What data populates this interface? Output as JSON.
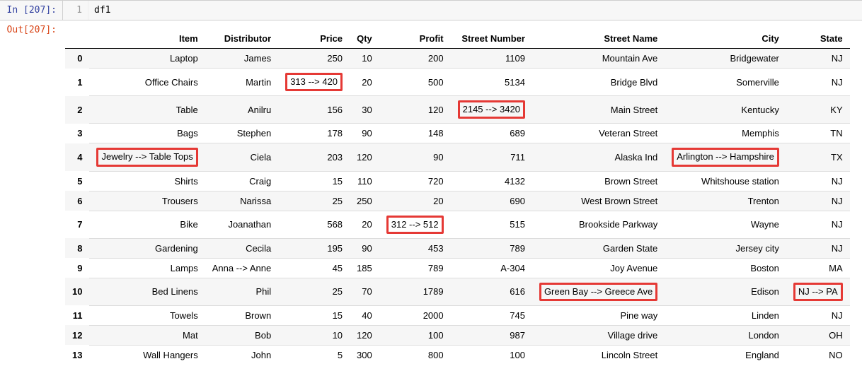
{
  "input_cell": {
    "prompt": "In [207]:",
    "line_number": "1",
    "code": "df1"
  },
  "output_cell": {
    "prompt": "Out[207]:"
  },
  "table": {
    "columns": [
      "Item",
      "Distributor",
      "Price",
      "Qty",
      "Profit",
      "Street Number",
      "Street Name",
      "City",
      "State"
    ],
    "highlight_map": {
      "1": [
        "Price"
      ],
      "2": [
        "Street Number"
      ],
      "4": [
        "Item",
        "City"
      ],
      "7": [
        "Profit"
      ],
      "10": [
        "Street Name",
        "State"
      ]
    },
    "rows": [
      {
        "idx": "0",
        "Item": "Laptop",
        "Distributor": "James",
        "Price": "250",
        "Qty": "10",
        "Profit": "200",
        "Street Number": "1109",
        "Street Name": "Mountain Ave",
        "City": "Bridgewater",
        "State": "NJ"
      },
      {
        "idx": "1",
        "Item": "Office Chairs",
        "Distributor": "Martin",
        "Price": "313 --> 420",
        "Qty": "20",
        "Profit": "500",
        "Street Number": "5134",
        "Street Name": "Bridge Blvd",
        "City": "Somerville",
        "State": "NJ"
      },
      {
        "idx": "2",
        "Item": "Table",
        "Distributor": "Anilru",
        "Price": "156",
        "Qty": "30",
        "Profit": "120",
        "Street Number": "2145 --> 3420",
        "Street Name": "Main Street",
        "City": "Kentucky",
        "State": "KY"
      },
      {
        "idx": "3",
        "Item": "Bags",
        "Distributor": "Stephen",
        "Price": "178",
        "Qty": "90",
        "Profit": "148",
        "Street Number": "689",
        "Street Name": "Veteran Street",
        "City": "Memphis",
        "State": "TN"
      },
      {
        "idx": "4",
        "Item": "Jewelry --> Table Tops",
        "Distributor": "Ciela",
        "Price": "203",
        "Qty": "120",
        "Profit": "90",
        "Street Number": "711",
        "Street Name": "Alaska Ind",
        "City": "Arlington --> Hampshire",
        "State": "TX"
      },
      {
        "idx": "5",
        "Item": "Shirts",
        "Distributor": "Craig",
        "Price": "15",
        "Qty": "110",
        "Profit": "720",
        "Street Number": "4132",
        "Street Name": "Brown Street",
        "City": "Whitshouse station",
        "State": "NJ"
      },
      {
        "idx": "6",
        "Item": "Trousers",
        "Distributor": "Narissa",
        "Price": "25",
        "Qty": "250",
        "Profit": "20",
        "Street Number": "690",
        "Street Name": "West Brown Street",
        "City": "Trenton",
        "State": "NJ"
      },
      {
        "idx": "7",
        "Item": "Bike",
        "Distributor": "Joanathan",
        "Price": "568",
        "Qty": "20",
        "Profit": "312 --> 512",
        "Street Number": "515",
        "Street Name": "Brookside Parkway",
        "City": "Wayne",
        "State": "NJ"
      },
      {
        "idx": "8",
        "Item": "Gardening",
        "Distributor": "Cecila",
        "Price": "195",
        "Qty": "90",
        "Profit": "453",
        "Street Number": "789",
        "Street Name": "Garden State",
        "City": "Jersey city",
        "State": "NJ"
      },
      {
        "idx": "9",
        "Item": "Lamps",
        "Distributor": "Anna --> Anne",
        "Price": "45",
        "Qty": "185",
        "Profit": "789",
        "Street Number": "A-304",
        "Street Name": "Joy Avenue",
        "City": "Boston",
        "State": "MA"
      },
      {
        "idx": "10",
        "Item": "Bed Linens",
        "Distributor": "Phil",
        "Price": "25",
        "Qty": "70",
        "Profit": "1789",
        "Street Number": "616",
        "Street Name": "Green Bay --> Greece Ave",
        "City": "Edison",
        "State": "NJ --> PA"
      },
      {
        "idx": "11",
        "Item": "Towels",
        "Distributor": "Brown",
        "Price": "15",
        "Qty": "40",
        "Profit": "2000",
        "Street Number": "745",
        "Street Name": "Pine way",
        "City": "Linden",
        "State": "NJ"
      },
      {
        "idx": "12",
        "Item": "Mat",
        "Distributor": "Bob",
        "Price": "10",
        "Qty": "120",
        "Profit": "100",
        "Street Number": "987",
        "Street Name": "Village drive",
        "City": "London",
        "State": "OH"
      },
      {
        "idx": "13",
        "Item": "Wall Hangers",
        "Distributor": "John",
        "Price": "5",
        "Qty": "300",
        "Profit": "800",
        "Street Number": "100",
        "Street Name": "Lincoln Street",
        "City": "England",
        "State": "NO"
      }
    ]
  }
}
